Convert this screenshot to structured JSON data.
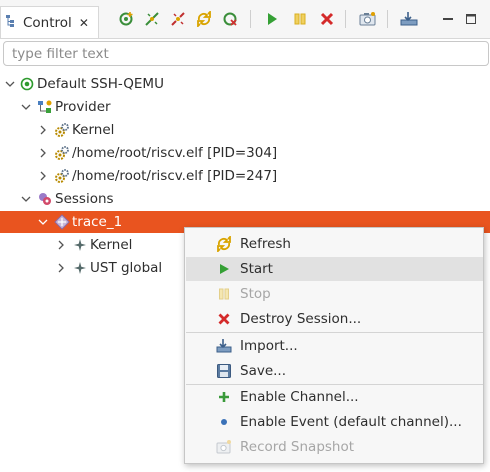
{
  "view_tab": {
    "label": "Control",
    "close": "✕"
  },
  "toolbar": {
    "buttons": [
      "new-connection-icon",
      "connect-icon",
      "disconnect-icon",
      "refresh-icon",
      "delete-connection-icon",
      "start-icon",
      "stop-icon",
      "destroy-icon",
      "record-snapshot-icon",
      "import-icon",
      "minimize-icon",
      "maximize-icon"
    ]
  },
  "filter": {
    "placeholder": "type filter text",
    "value": ""
  },
  "tree": {
    "root": "Default SSH-QEMU",
    "provider": "Provider",
    "provider_children": [
      "Kernel",
      "/home/root/riscv.elf [PID=304]",
      "/home/root/riscv.elf [PID=247]"
    ],
    "sessions": "Sessions",
    "session": "trace_1",
    "session_children": [
      "Kernel",
      "UST global"
    ]
  },
  "colors": {
    "selection": "#e9541f",
    "menu_hover": "#e1e1e1"
  },
  "context_menu": {
    "items": [
      {
        "label": "Refresh",
        "icon": "refresh-icon",
        "enabled": true
      },
      {
        "label": "Start",
        "icon": "start-icon",
        "enabled": true,
        "hovered": true
      },
      {
        "label": "Stop",
        "icon": "stop-icon",
        "enabled": false
      },
      {
        "label": "Destroy Session...",
        "icon": "destroy-icon",
        "enabled": true
      },
      {
        "label": "Import...",
        "icon": "import-icon",
        "enabled": true
      },
      {
        "label": "Save...",
        "icon": "save-icon",
        "enabled": true
      },
      {
        "label": "Enable Channel...",
        "icon": "enable-channel-icon",
        "enabled": true
      },
      {
        "label": "Enable Event (default channel)...",
        "icon": "enable-event-icon",
        "enabled": true
      },
      {
        "label": "Record Snapshot",
        "icon": "record-snapshot-icon",
        "enabled": false
      }
    ]
  }
}
